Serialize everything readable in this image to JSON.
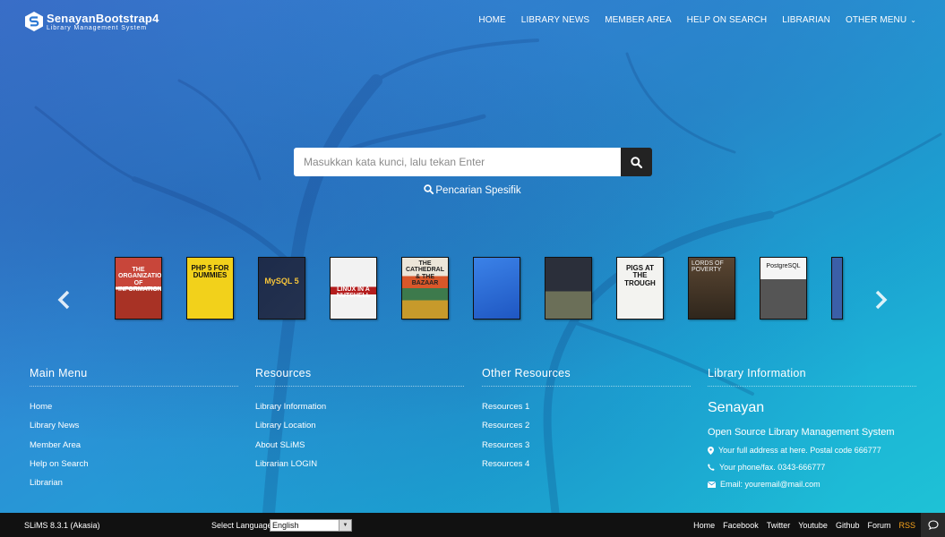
{
  "brand": {
    "name_a": "Senayan",
    "name_b": "Bootstrap4",
    "tagline": "Library Management System"
  },
  "nav": [
    "HOME",
    "LIBRARY NEWS",
    "MEMBER AREA",
    "HELP ON SEARCH",
    "LIBRARIAN",
    "OTHER MENU"
  ],
  "search": {
    "placeholder": "Masukkan kata kunci, lalu tekan Enter",
    "advanced_label": "Pencarian Spesifik"
  },
  "books": [
    {
      "cover": "#b93a2c",
      "title": "THE ORGANIZATION OF INFORMATION"
    },
    {
      "cover": "#f2d11b",
      "title": "PHP 5 FOR DUMMIES"
    },
    {
      "cover": "#1d2b4a",
      "title": "MySQL 5"
    },
    {
      "cover": "#f2f2f2",
      "title": "LINUX IN A NUTSHELL"
    },
    {
      "cover": "#ece6d9",
      "title": "THE CATHEDRAL & THE BAZAAR"
    },
    {
      "cover": "#2f6fd8",
      "title": ""
    },
    {
      "cover": "#2b2f3a",
      "title": ""
    },
    {
      "cover": "#f3f3f0",
      "title": "PIGS AT THE TROUGH"
    },
    {
      "cover": "#4a3a2a",
      "title": "LORDS OF POVERTY"
    },
    {
      "cover": "#f5f5f5",
      "title": "PostgreSQL"
    },
    {
      "cover": "#3b5fa8",
      "title": ""
    }
  ],
  "footer": {
    "main_menu": {
      "title": "Main Menu",
      "items": [
        "Home",
        "Library News",
        "Member Area",
        "Help on Search",
        "Librarian"
      ]
    },
    "resources": {
      "title": "Resources",
      "items": [
        "Library Information",
        "Library Location",
        "About SLiMS",
        "Librarian LOGIN"
      ]
    },
    "other_resources": {
      "title": "Other Resources",
      "items": [
        "Resources 1",
        "Resources 2",
        "Resources 3",
        "Resources 4"
      ]
    },
    "library_info": {
      "title": "Library Information",
      "name": "Senayan",
      "description": "Open Source Library Management System",
      "address": "Your full address at here. Postal code 666777",
      "phone": "Your phone/fax. 0343-666777",
      "email": "Email: youremail@mail.com"
    }
  },
  "bottombar": {
    "version": "SLiMS 8.3.1 (Akasia)",
    "language_label": "Select Language",
    "language_selected": "English",
    "links": [
      "Home",
      "Facebook",
      "Twitter",
      "Youtube",
      "Github",
      "Forum",
      "RSS"
    ]
  },
  "colors": {
    "rss": "#f7a21b",
    "bottombar": "#111111",
    "search_button": "#232323"
  }
}
